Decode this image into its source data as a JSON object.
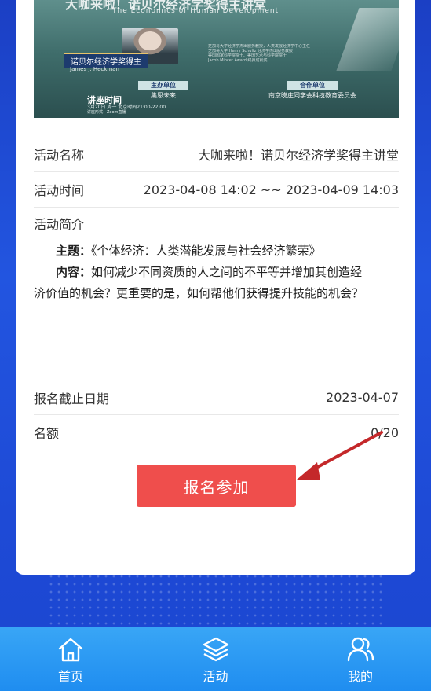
{
  "banner": {
    "title_cn": "大咖来啦！诺贝尔经济学奖得主讲堂",
    "title_en": "The Economics of Human Development",
    "laureate_badge": "诺贝尔经济学奖得主",
    "speaker_en": "James J. Heckman",
    "bullets": [
      "芝加哥大学经济学杰出服务教授，人类发展经济学中心主任",
      "芝加哥大学 Henry Schultz 经济学杰出服务教授",
      "美国国家科学院院士、美国艺术与科学院院士",
      "Jacob Mincer Award 终身成就奖"
    ],
    "host_tag": "主办单位",
    "host_org": "集思未来",
    "partner_tag": "合作单位",
    "partner_org": "南京晓庄同学会科技教育委员会",
    "time_title": "讲座时间",
    "time_text": "3月20日 周一 北京时间21:00-22:00",
    "format_text": "讲座形式：Zoom直播"
  },
  "event": {
    "name_label": "活动名称",
    "name_value": "大咖来啦！诺贝尔经济学奖得主讲堂",
    "time_label": "活动时间",
    "time_value": "2023-04-08 14:02 ~~ 2023-04-09 14:03",
    "intro_label": "活动简介",
    "topic_label": "主题：",
    "topic_value": "《个体经济：人类潜能发展与社会经济繁荣》",
    "content_label": "内容：",
    "content_value_1": "如何减少不同资质的人之间的不平等并增加其创造经",
    "content_value_2": "济价值的机会？更重要的是，如何帮他们获得提升技能的机会？",
    "deadline_label": "报名截止日期",
    "deadline_value": "2023-04-07",
    "quota_label": "名额",
    "quota_value": "0/20"
  },
  "cta": {
    "label": "报名参加"
  },
  "tabbar": {
    "items": [
      {
        "label": "首页",
        "icon": "home-icon"
      },
      {
        "label": "活动",
        "icon": "layers-icon"
      },
      {
        "label": "我的",
        "icon": "users-icon"
      }
    ]
  },
  "colors": {
    "accent_red": "#ef4e4c",
    "tabbar_blue": "#1f8df0",
    "background_blue": "#2255e0"
  }
}
